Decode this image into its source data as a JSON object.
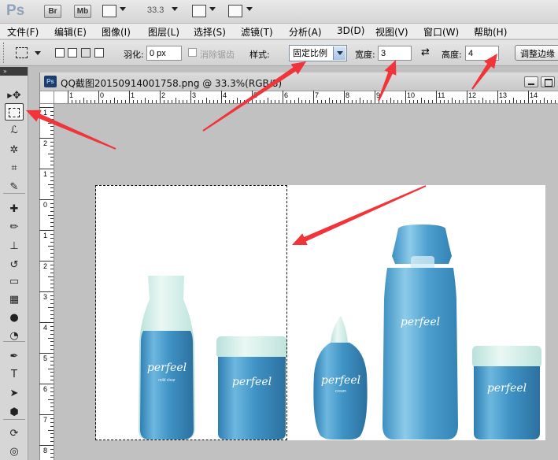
{
  "appbar": {
    "logo": "Ps",
    "bridge_label": "Br",
    "minibridge_label": "Mb",
    "zoom": "33.3"
  },
  "menu": [
    "文件(F)",
    "编辑(E)",
    "图像(I)",
    "图层(L)",
    "选择(S)",
    "滤镜(T)",
    "分析(A)",
    "3D(D)",
    "视图(V)",
    "窗口(W)",
    "帮助(H)"
  ],
  "options": {
    "feather_label": "羽化:",
    "feather_value": "0 px",
    "antialias_label": "消除锯齿",
    "style_label": "样式:",
    "style_value": "固定比例",
    "width_label": "宽度:",
    "width_value": "3",
    "swap_icon": "⇄",
    "height_label": "高度:",
    "height_value": "4",
    "refine_edge_label": "调整边缘"
  },
  "document": {
    "title": "QQ截图20150914001758.png @ 33.3%(RGB/8)",
    "ps_badge": "Ps"
  },
  "rulers": {
    "h": [
      "1",
      "0",
      "1",
      "2",
      "3",
      "4",
      "5",
      "6",
      "7",
      "8",
      "9",
      "10",
      "11",
      "12",
      "13",
      "14"
    ],
    "v": [
      "1",
      "2",
      "1",
      "0",
      "1",
      "2",
      "3",
      "4",
      "5",
      "6",
      "7",
      "8"
    ]
  },
  "products": {
    "brand": "perfeel",
    "bottle1_sub": "mild clear",
    "bottle3_sub": "cream"
  },
  "colors": {
    "annotation": "#f0343a",
    "bottle_blue": "#4a9ac6",
    "cap_pale": "#d6eee9"
  },
  "tools": [
    "move-tool",
    "marquee-tool",
    "lasso-tool",
    "quick-select-tool",
    "crop-tool",
    "eyedropper-tool",
    "healing-brush-tool",
    "brush-tool",
    "clone-stamp-tool",
    "history-brush-tool",
    "eraser-tool",
    "gradient-tool",
    "blur-tool",
    "dodge-tool",
    "pen-tool",
    "type-tool",
    "path-select-tool",
    "shape-tool",
    "3d-rotate-tool",
    "3d-orbit-tool"
  ]
}
